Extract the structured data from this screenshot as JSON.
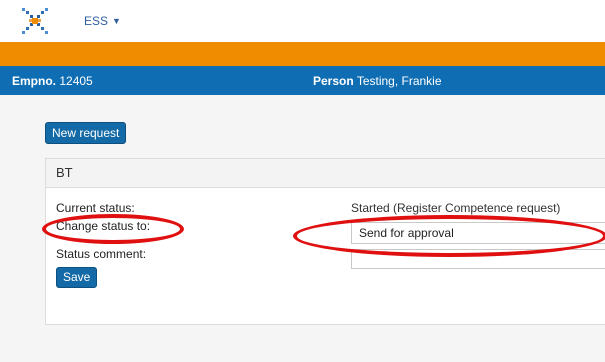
{
  "nav": {
    "menu_label": "ESS",
    "caret": "▼"
  },
  "info_bar": {
    "empno_label": "Empno.",
    "empno_value": "12405",
    "person_label": "Person",
    "person_value": "Testing, Frankie"
  },
  "actions": {
    "new_request_label": "New request"
  },
  "panel": {
    "title": "BT",
    "current_status_label": "Current status:",
    "current_status_value": "Started (Register Competence request)",
    "change_status_label": "Change status to:",
    "change_status_selected": "Send for approval",
    "status_comment_label": "Status comment:",
    "status_comment_value": "",
    "save_label": "Save"
  },
  "colors": {
    "orange_bar": "#ef8c00",
    "info_bar": "#0f6eb3",
    "button": "#136aa6",
    "highlight_ellipse": "#e01010"
  }
}
